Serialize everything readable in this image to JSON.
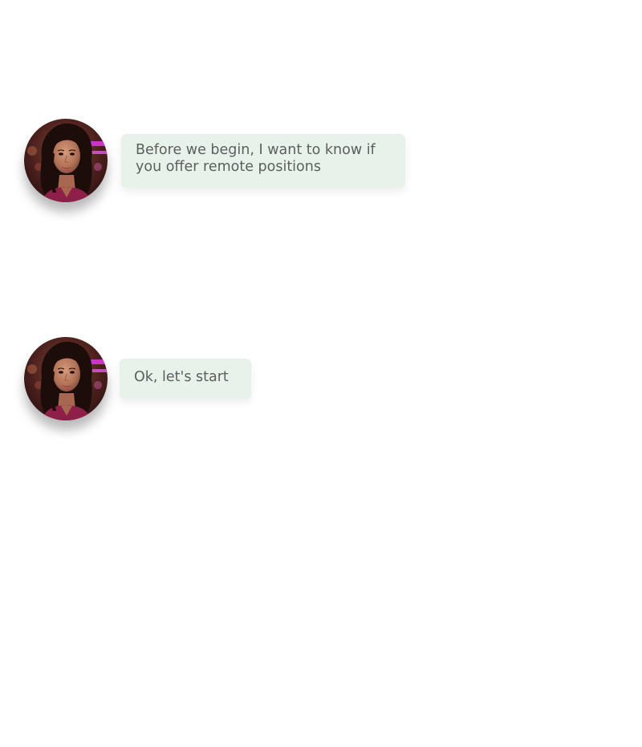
{
  "messages": [
    {
      "avatar_icon": "woman-portrait-avatar",
      "text": "Before we begin, I want to know if you offer remote positions"
    },
    {
      "avatar_icon": "woman-portrait-avatar",
      "text": "Ok, let's start"
    }
  ],
  "colors": {
    "bubble_background": "#e7f2ea",
    "bubble_text": "#5d5f5c",
    "page_background": "#ffffff"
  }
}
